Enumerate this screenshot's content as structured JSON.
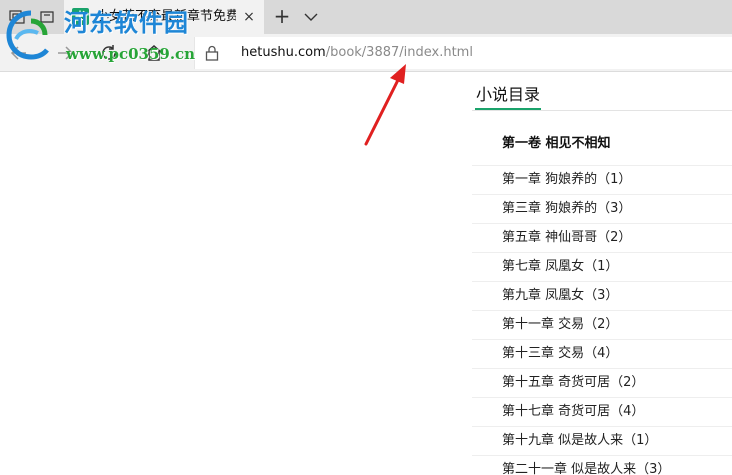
{
  "browser": {
    "tab": {
      "favicon": "书",
      "title": "小女花不弃最新章节免费",
      "close": "×"
    },
    "new_tab": "+",
    "address": {
      "host": "hetushu.com",
      "path": "/book/3887/index.html"
    }
  },
  "watermark": {
    "name": "河东软件园",
    "url": "www.pc0359.cn"
  },
  "toc": {
    "title": "小说目录",
    "volume": "第一卷 相见不相知",
    "chapters": [
      "第一章 狗娘养的（1）",
      "第三章 狗娘养的（3）",
      "第五章 神仙哥哥（2）",
      "第七章 凤凰女（1）",
      "第九章 凤凰女（3）",
      "第十一章 交易（2）",
      "第十三章 交易（4）",
      "第十五章 奇货可居（2）",
      "第十七章 奇货可居（4）",
      "第十九章 似是故人来（1）",
      "第二十一章 似是故人来（3）"
    ]
  },
  "colors": {
    "accent": "#1aa36b",
    "arrow": "#e02020",
    "watermark_blue": "#1e86d6",
    "watermark_green": "#27a537"
  }
}
